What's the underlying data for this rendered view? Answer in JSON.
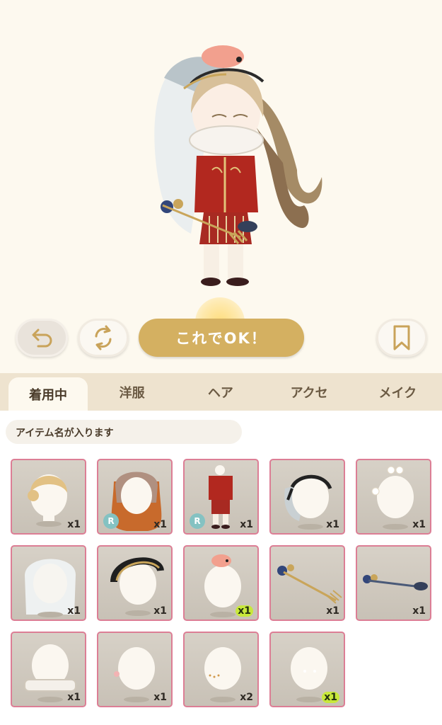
{
  "toolbar": {
    "undo_icon": "undo-arrow-icon",
    "random_icon": "shuffle-icon",
    "ok_label": "これでOK！",
    "bookmark_icon": "bookmark-icon"
  },
  "tabs": [
    {
      "label": "着用中",
      "active": true
    },
    {
      "label": "洋服",
      "active": false
    },
    {
      "label": "ヘア",
      "active": false
    },
    {
      "label": "アクセ",
      "active": false
    },
    {
      "label": "メイク",
      "active": false
    }
  ],
  "item_name_placeholder": "アイテム名が入ります",
  "items": [
    {
      "name": "blonde-braid-hair",
      "qty": "x1",
      "rarity": ""
    },
    {
      "name": "long-gradient-hair",
      "qty": "x1",
      "rarity": "R"
    },
    {
      "name": "red-gold-outfit",
      "qty": "x1",
      "rarity": "R"
    },
    {
      "name": "black-headband-veil",
      "qty": "x1",
      "rarity": ""
    },
    {
      "name": "white-flower-pins",
      "qty": "x1",
      "rarity": ""
    },
    {
      "name": "white-veil",
      "qty": "x1",
      "rarity": ""
    },
    {
      "name": "black-gold-leaf-crown",
      "qty": "x1",
      "rarity": ""
    },
    {
      "name": "shrimp-hat",
      "qty": "x1",
      "rarity": "",
      "new": true
    },
    {
      "name": "star-fork-bouquet",
      "qty": "x1",
      "rarity": ""
    },
    {
      "name": "star-spoon-bouquet",
      "qty": "x1",
      "rarity": ""
    },
    {
      "name": "white-ruff-collar",
      "qty": "x1",
      "rarity": ""
    },
    {
      "name": "blush-makeup",
      "qty": "x1",
      "rarity": ""
    },
    {
      "name": "freckles-makeup",
      "qty": "x2",
      "rarity": ""
    },
    {
      "name": "highlight-makeup",
      "qty": "x1",
      "rarity": "",
      "new": true
    }
  ],
  "colors": {
    "accent_gold": "#d4b061",
    "cell_border": "#dc7e95",
    "new_badge": "#c8e83b",
    "rarity_badge": "#84c2c2"
  }
}
